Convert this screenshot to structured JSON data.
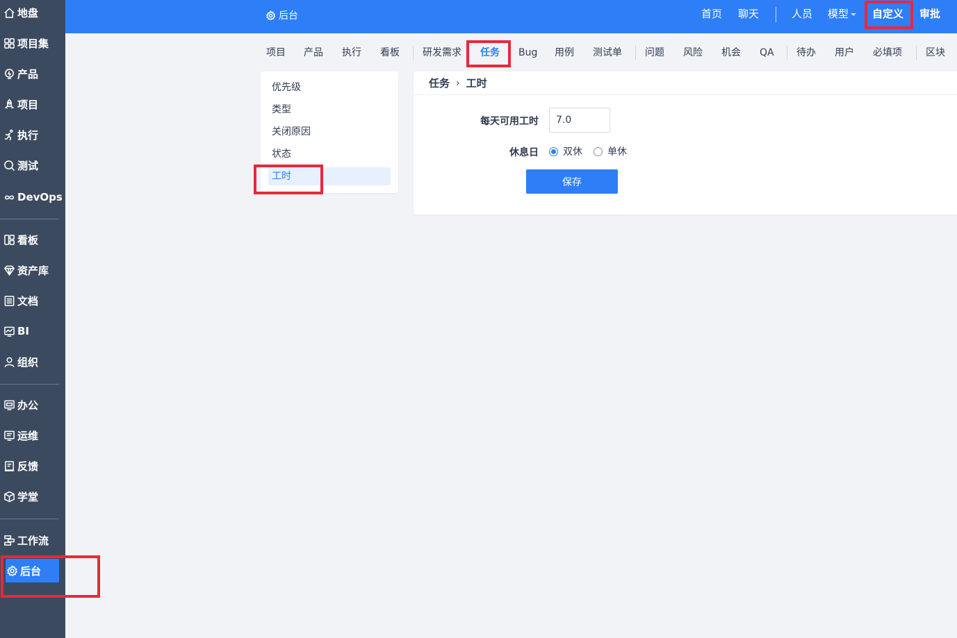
{
  "sidebar": {
    "items": [
      {
        "label": "地盘"
      },
      {
        "label": "项目集"
      },
      {
        "label": "产品"
      },
      {
        "label": "项目"
      },
      {
        "label": "执行"
      },
      {
        "label": "测试"
      },
      {
        "label": "DevOps"
      },
      {
        "label": "看板"
      },
      {
        "label": "资产库"
      },
      {
        "label": "文档"
      },
      {
        "label": "BI"
      },
      {
        "label": "组织"
      },
      {
        "label": "办公"
      },
      {
        "label": "运维"
      },
      {
        "label": "反馈"
      },
      {
        "label": "学堂"
      },
      {
        "label": "工作流"
      },
      {
        "label": "后台"
      }
    ],
    "active_index": 17
  },
  "topbar": {
    "crumb": "后台",
    "nav": [
      "首页",
      "聊天",
      "人员",
      "模型",
      "自定义",
      "审批"
    ],
    "active": "自定义"
  },
  "subnav": {
    "items": [
      "项目",
      "产品",
      "执行",
      "看板",
      "研发需求",
      "任务",
      "Bug",
      "用例",
      "测试单",
      "问题",
      "风险",
      "机会",
      "QA",
      "待办",
      "用户",
      "必填项",
      "区块"
    ],
    "active": "任务"
  },
  "menu": {
    "items": [
      "优先级",
      "类型",
      "关闭原因",
      "状态",
      "工时"
    ],
    "active": "工时"
  },
  "panel": {
    "breadcrumb_parent": "任务",
    "breadcrumb_sep": "›",
    "breadcrumb_current": "工时",
    "hours_label": "每天可用工时",
    "hours_value": "7.0",
    "rest_label": "休息日",
    "rest_options": [
      "双休",
      "单休"
    ],
    "rest_selected": "双休",
    "save_label": "保存"
  },
  "colors": {
    "accent": "#2e7ff7",
    "sidebar_bg": "#3c4a5f",
    "highlight": "#e8283a"
  }
}
